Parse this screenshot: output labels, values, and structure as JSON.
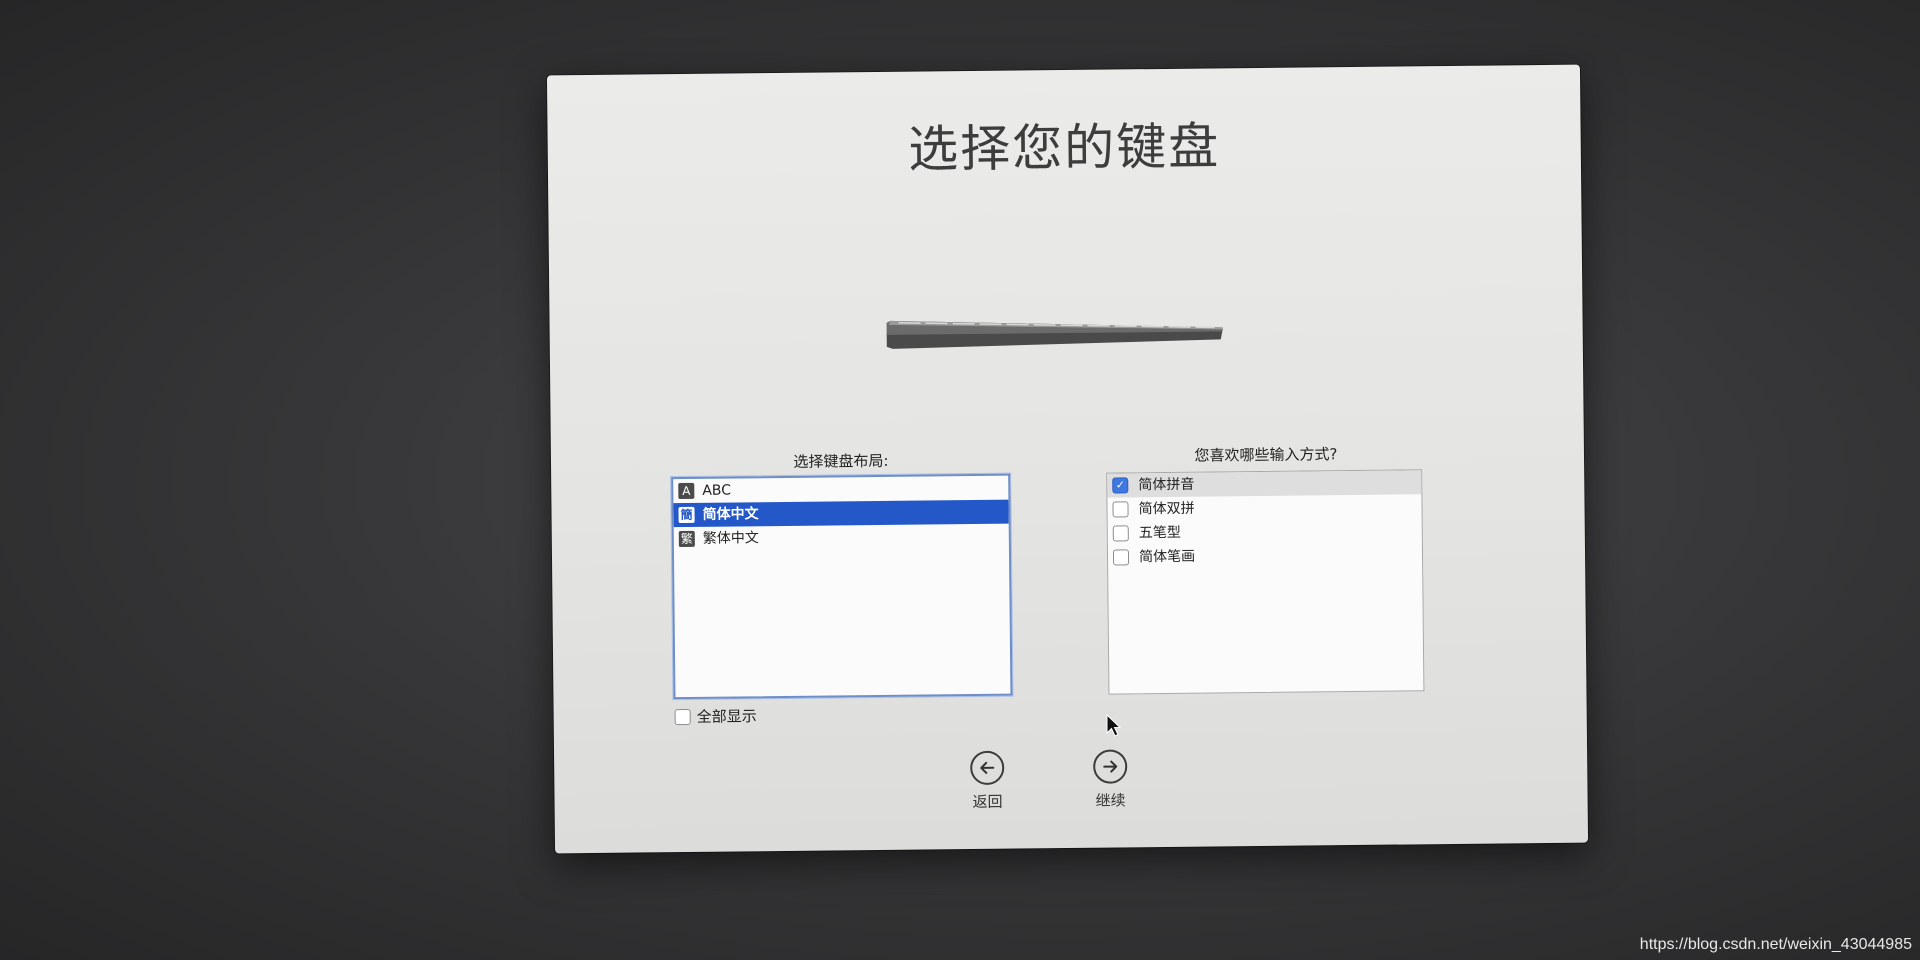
{
  "window": {
    "title": "选择您的键盘"
  },
  "layouts": {
    "label": "选择键盘布局:",
    "items": [
      {
        "icon": "A",
        "label": "ABC",
        "selected": false
      },
      {
        "icon": "簡",
        "label": "简体中文",
        "selected": true
      },
      {
        "icon": "繁",
        "label": "繁体中文",
        "selected": false
      }
    ],
    "show_all_label": "全部显示",
    "show_all_checked": false
  },
  "input_methods": {
    "label": "您喜欢哪些输入方式?",
    "items": [
      {
        "label": "简体拼音",
        "checked": true
      },
      {
        "label": "简体双拼",
        "checked": false
      },
      {
        "label": "五笔型",
        "checked": false
      },
      {
        "label": "简体笔画",
        "checked": false
      }
    ]
  },
  "nav": {
    "back_label": "返回",
    "continue_label": "继续"
  },
  "watermark": "https://blog.csdn.net/weixin_43044985",
  "colors": {
    "selection": "#2458c8",
    "checkbox_on": "#3f78e0"
  }
}
